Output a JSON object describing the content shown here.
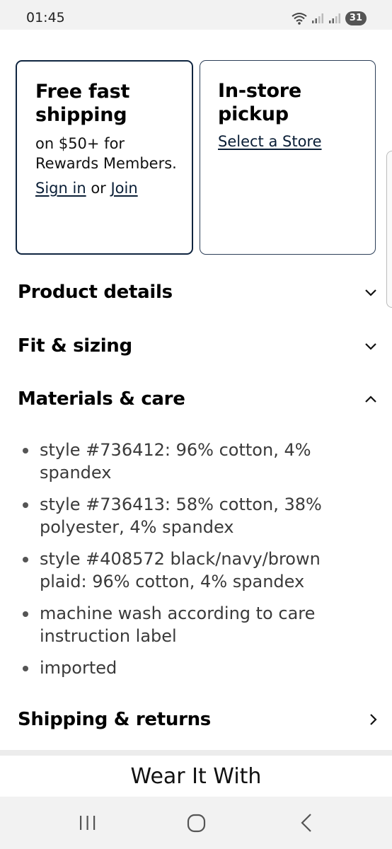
{
  "status": {
    "time": "01:45",
    "battery": "31",
    "icons": [
      "wifi-icon",
      "signal-icon",
      "signal-icon",
      "battery-icon"
    ]
  },
  "shipping_card": {
    "title": "Free fast shipping",
    "text": "on $50+ for Rewards Members.",
    "sign_in": "Sign in",
    "or": "or",
    "join": "Join"
  },
  "pickup_card": {
    "title": "In-store pickup",
    "link": "Select a Store"
  },
  "accordion": {
    "product_details": "Product details",
    "fit_sizing": "Fit & sizing",
    "materials_care": "Materials & care",
    "shipping_returns": "Shipping & returns"
  },
  "materials": [
    "style #736412: 96% cotton, 4% spandex",
    "style #736413: 58% cotton, 38% polyester, 4% spandex",
    "style #408572 black/navy/brown plaid: 96% cotton, 4% spandex",
    "machine wash according to care instruction label",
    "imported"
  ],
  "wear_it_with": "Wear It With",
  "nav": [
    "recent-apps-icon",
    "home-icon",
    "back-icon"
  ]
}
